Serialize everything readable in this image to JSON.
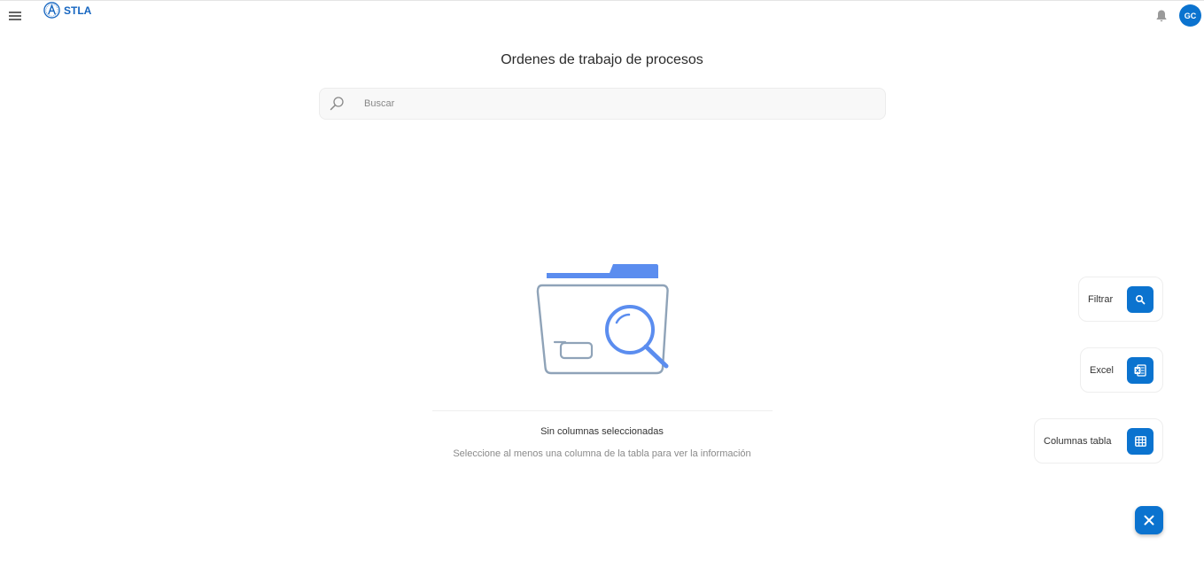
{
  "header": {
    "brand": "STLA",
    "avatar_initials": "GC",
    "icons": {
      "menu": "menu-icon",
      "bell": "bell-icon",
      "logo": "logo-icon"
    }
  },
  "page": {
    "title": "Ordenes de trabajo de procesos"
  },
  "search": {
    "placeholder": "Buscar"
  },
  "empty_state": {
    "title": "Sin columnas seleccionadas",
    "subtitle": "Seleccione al menos una columna de la tabla para ver la información"
  },
  "actions": {
    "filter_label": "Filtrar",
    "excel_label": "Excel",
    "columns_label": "Columnas tabla"
  },
  "colors": {
    "accent": "#0b73cf",
    "illustration_blue": "#5b8def",
    "illustration_gray": "#8fa3b8"
  }
}
